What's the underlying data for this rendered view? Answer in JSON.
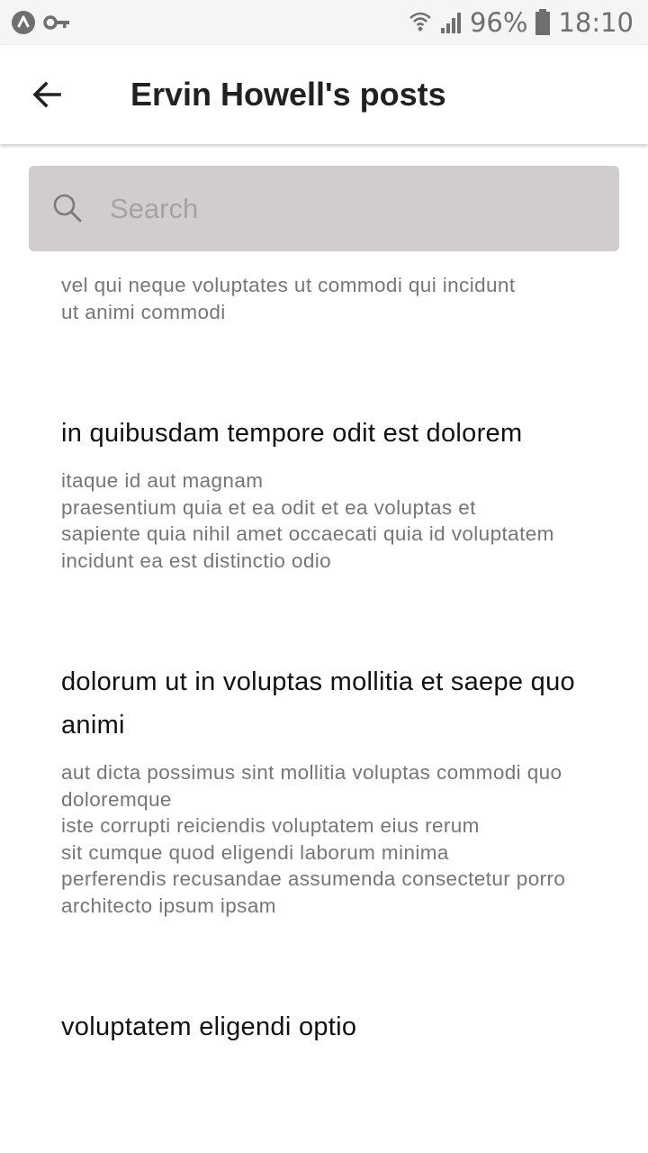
{
  "status_bar": {
    "battery": "96%",
    "time": "18:10",
    "icons": [
      "app-notification-icon",
      "vpn-key-icon",
      "wifi-icon",
      "signal-icon",
      "battery-icon"
    ]
  },
  "app_bar": {
    "title": "Ervin Howell's posts",
    "back_icon": "arrow-back-icon"
  },
  "search": {
    "placeholder": "Search",
    "value": ""
  },
  "posts": [
    {
      "title": "",
      "body": "vel qui neque voluptates ut commodi qui incidunt\nut animi commodi"
    },
    {
      "title": "in quibusdam tempore odit est dolorem",
      "body": "itaque id aut magnam\npraesentium quia et ea odit et ea voluptas et\nsapiente quia nihil amet occaecati quia id voluptatem\nincidunt ea est distinctio odio"
    },
    {
      "title": "dolorum ut in voluptas mollitia et saepe quo animi",
      "body": "aut dicta possimus sint mollitia voluptas commodi quo doloremque\niste corrupti reiciendis voluptatem eius rerum\nsit cumque quod eligendi laborum minima\nperferendis recusandae assumenda consectetur porro architecto ipsum ipsam"
    },
    {
      "title": "voluptatem eligendi optio",
      "body": ""
    }
  ],
  "colors": {
    "search_bg": "#d1cdcc",
    "title_text": "#212121",
    "body_text": "#767676"
  }
}
